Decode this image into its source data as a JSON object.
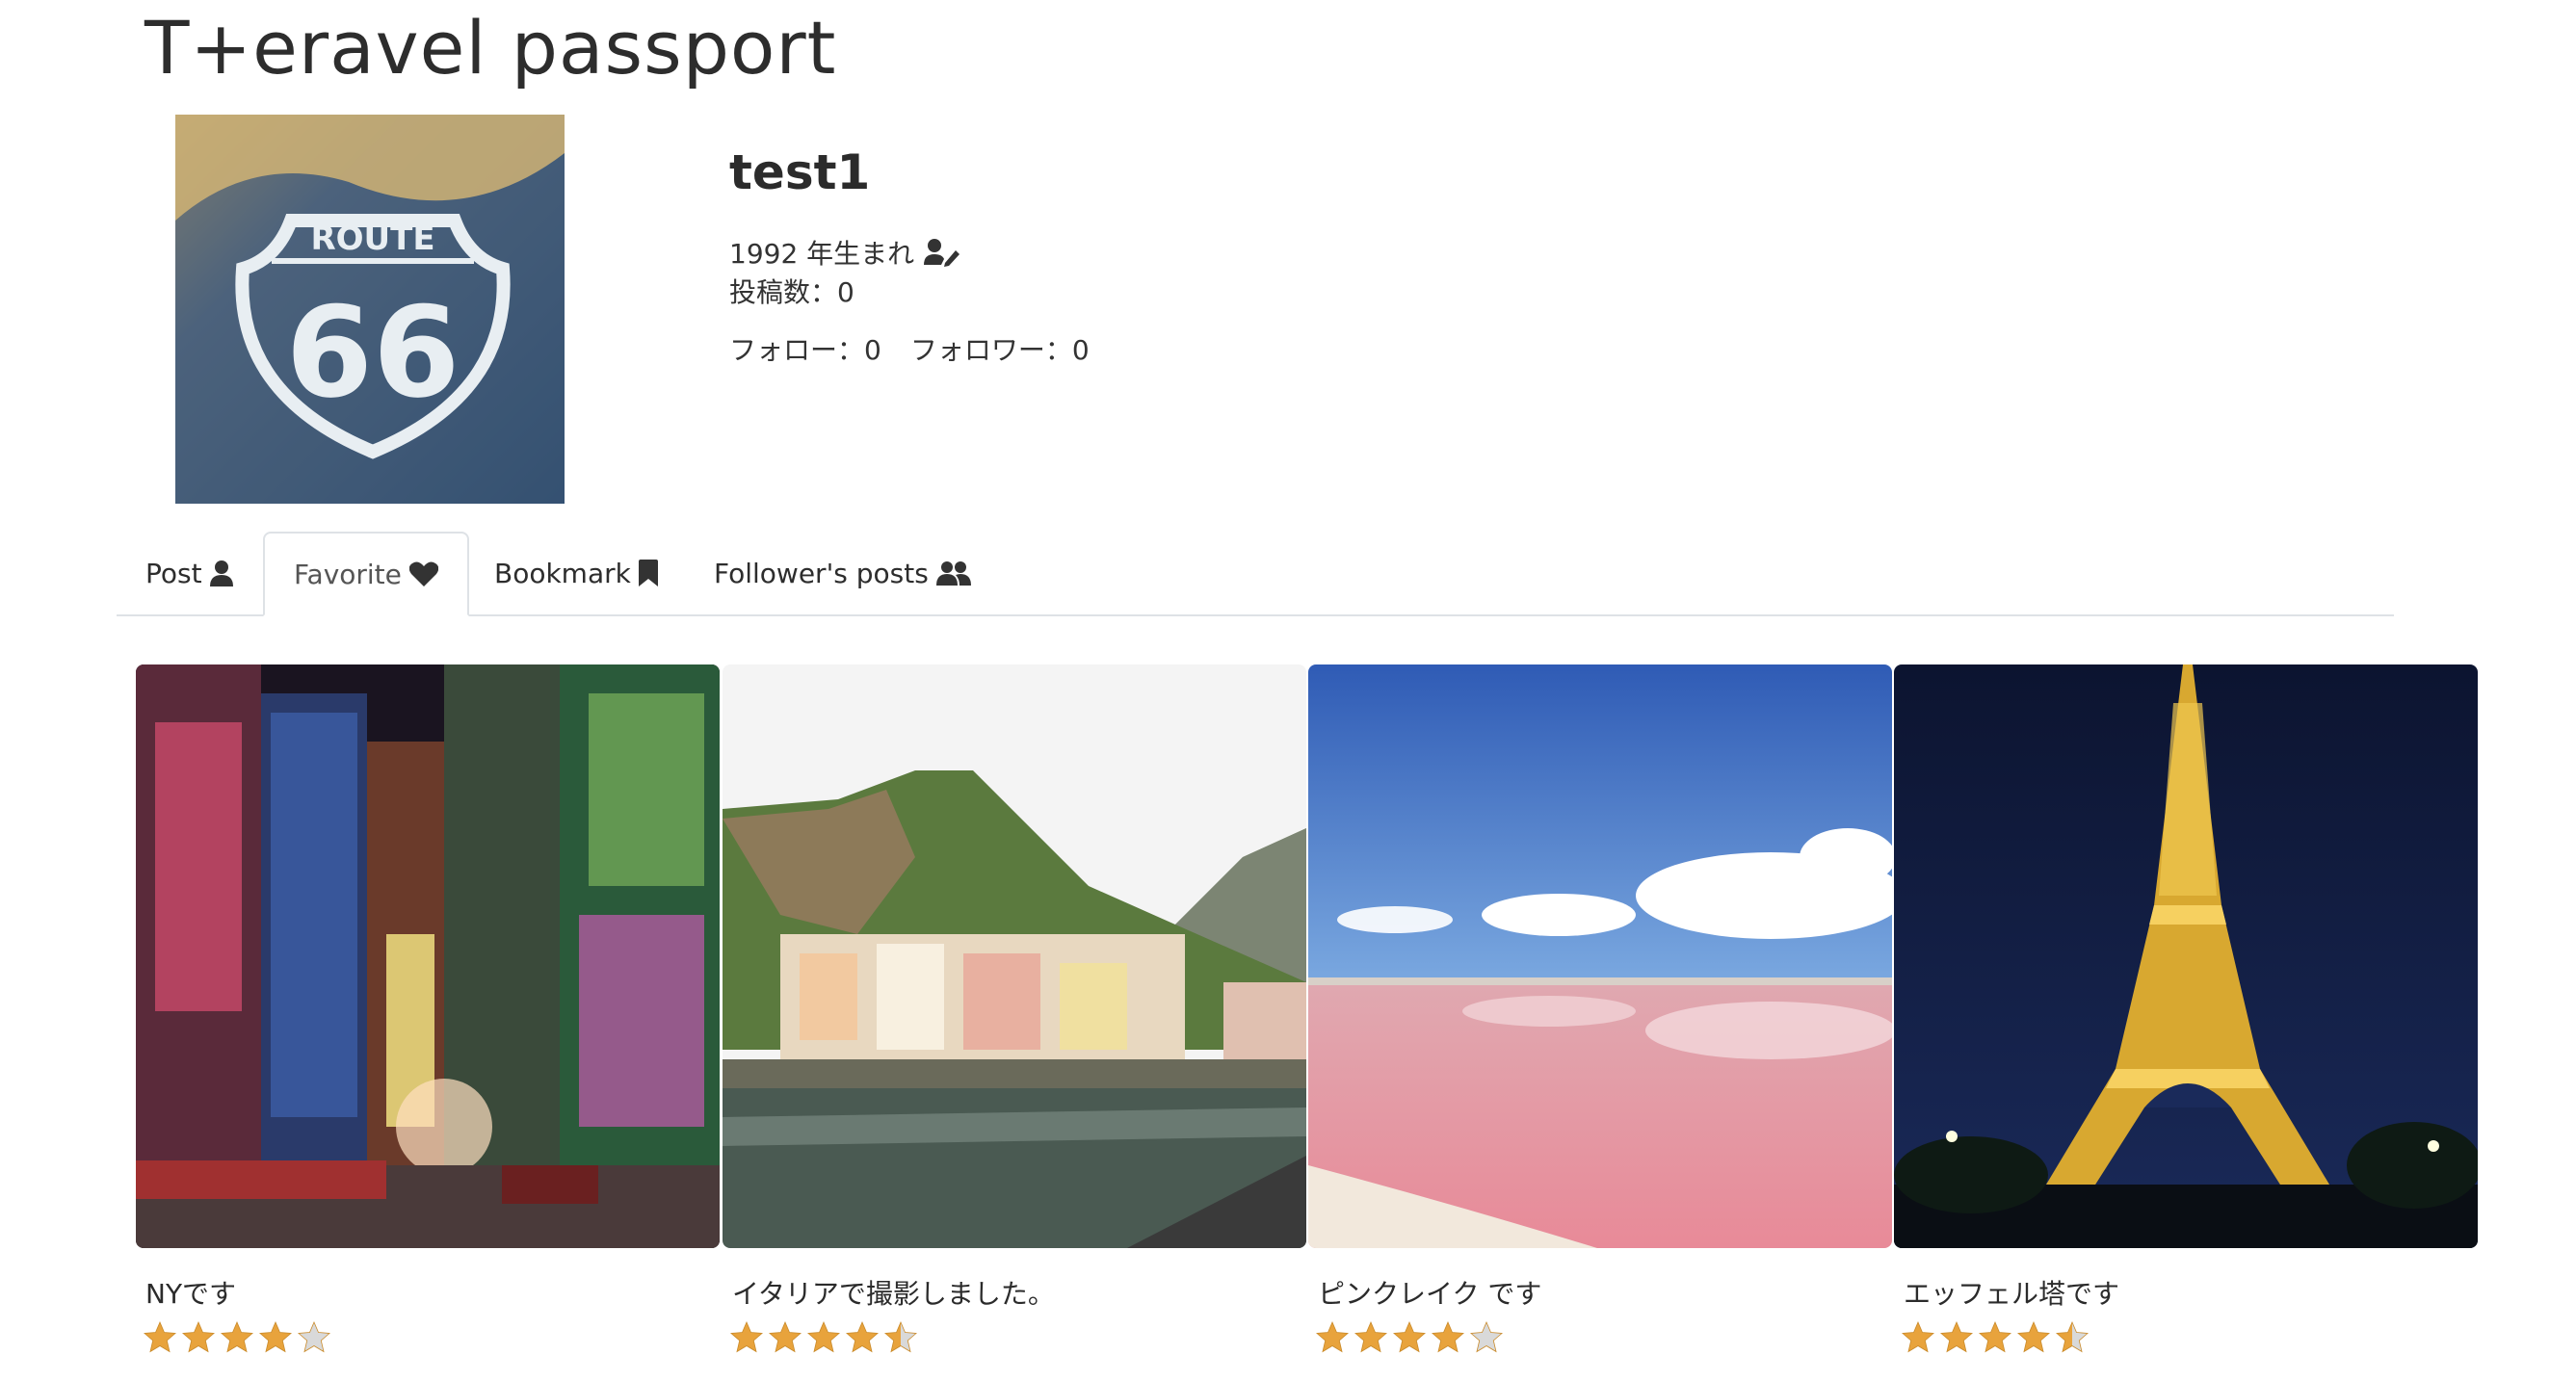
{
  "app": {
    "title": "T+eravel passport"
  },
  "profile": {
    "username": "test1",
    "birth": "1992 年生まれ",
    "posts": "投稿数：0",
    "follow": "フォロー：0",
    "followers": "フォロワー：0",
    "avatar_text_top": "ROUTE",
    "avatar_text_num": "66"
  },
  "tabs": [
    {
      "label": "Post",
      "icon": "user-icon",
      "active": false
    },
    {
      "label": "Favorite",
      "icon": "heart-icon",
      "active": true
    },
    {
      "label": "Bookmark",
      "icon": "bookmark-icon",
      "active": false
    },
    {
      "label": "Follower's posts",
      "icon": "users-icon",
      "active": false
    }
  ],
  "cards": [
    {
      "caption": "NYです",
      "rating": 4,
      "image": "city-night-street"
    },
    {
      "caption": "イタリアで撮影しました。",
      "rating": 4.5,
      "image": "coastal-village"
    },
    {
      "caption": "ピンクレイク です",
      "rating": 4,
      "image": "pink-lake"
    },
    {
      "caption": "エッフェル塔です",
      "rating": 4.5,
      "image": "eiffel-tower-night"
    }
  ],
  "colors": {
    "star": "#e8a33c",
    "star_empty": "#d9d9d9",
    "tab_border": "#dee2e6"
  }
}
